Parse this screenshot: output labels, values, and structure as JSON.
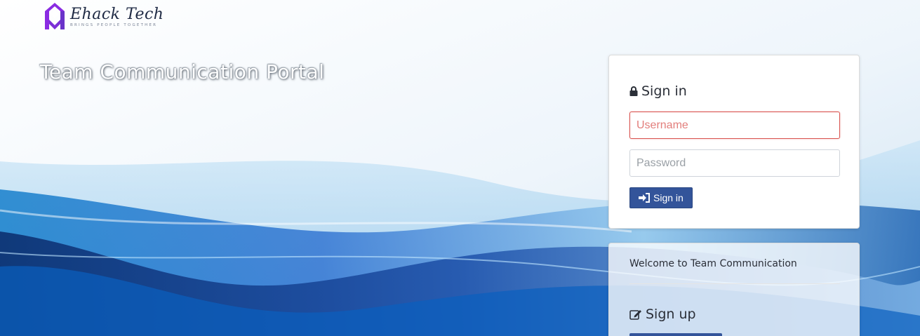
{
  "brand": {
    "name": "Ehack Tech",
    "tagline": "BRINGS PEOPLE TOGETHER",
    "logo_icon": "house-logo-icon",
    "colors": {
      "logo_primary": "#8a2be2",
      "logo_secondary": "#6a33c9"
    }
  },
  "hero": {
    "title": "Team Communication Portal"
  },
  "signin": {
    "heading": "Sign in",
    "heading_icon": "lock-icon",
    "username": {
      "placeholder": "Username",
      "value": ""
    },
    "password": {
      "placeholder": "Password",
      "value": ""
    },
    "button_label": "Sign in",
    "button_icon": "sign-in-icon"
  },
  "welcome": {
    "text": "Welcome to Team Communication",
    "signup_heading": "Sign up",
    "signup_icon": "edit-icon"
  },
  "colors": {
    "button_bg": "#33549a",
    "error_border": "#d9534f",
    "wave_blue": "#1f5fb4"
  }
}
